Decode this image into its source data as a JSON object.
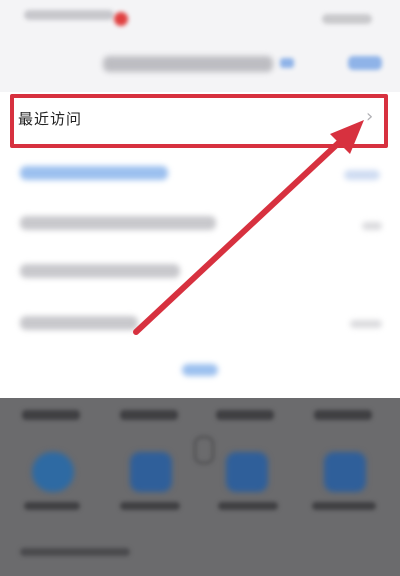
{
  "recent_row": {
    "label": "最近访问",
    "chevron": "›"
  },
  "annotation": {
    "color": "#d7313f"
  },
  "icons": {
    "chevron": "chevron-right-icon"
  }
}
